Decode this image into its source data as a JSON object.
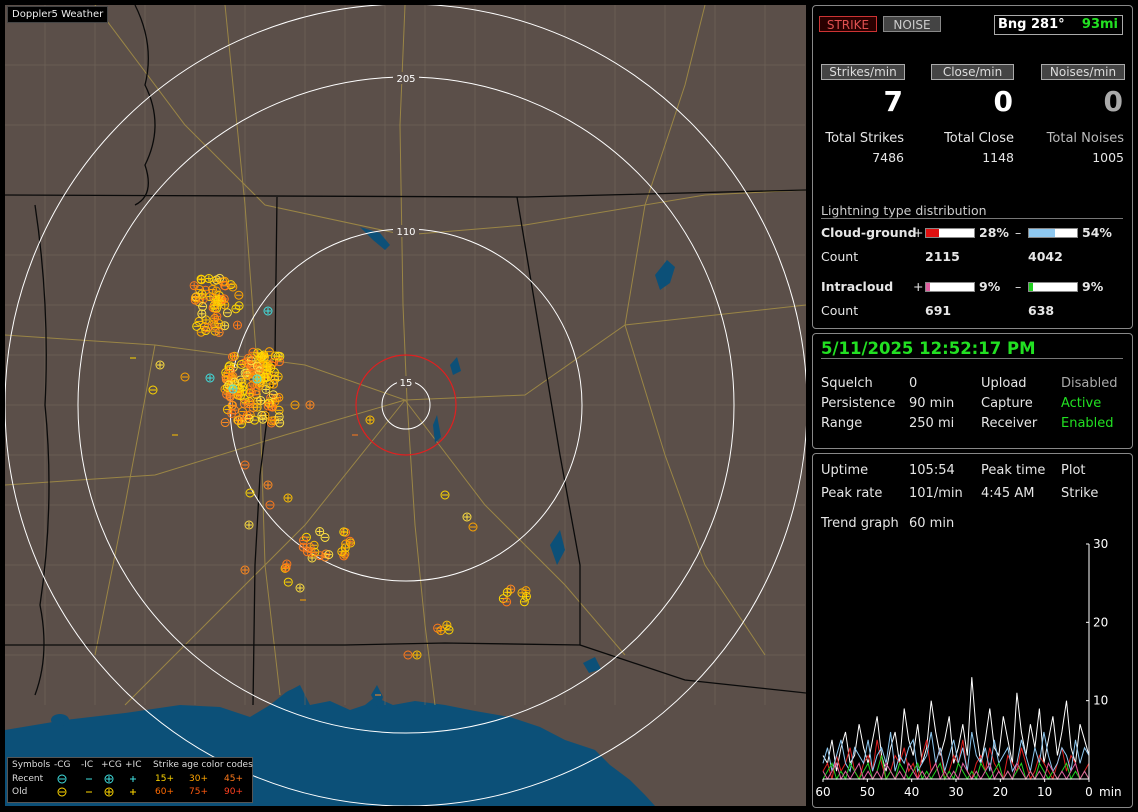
{
  "map": {
    "title": "Doppler5 Weather",
    "range_labels": [
      "205",
      "110",
      "15"
    ],
    "legend": {
      "symbols_label": "Symbols",
      "neg_cg": "-CG",
      "neg_ic": "-IC",
      "pos_cg": "+CG",
      "pos_ic": "+IC",
      "age_title": "Strike age color codes",
      "recent_label": "Recent",
      "old_label": "Old",
      "ages_recent": [
        "15+",
        "30+",
        "45+"
      ],
      "ages_old": [
        "60+",
        "75+",
        "90+"
      ],
      "age_colors": [
        "#ffd700",
        "#ffa500",
        "#ff7a1a",
        "#ff6a00",
        "#ff5a10",
        "#ff4020"
      ]
    },
    "colors": {
      "land": "#5b4f49",
      "water": "#0c5078",
      "state_border": "#0a0a0a",
      "county_border": "#6e6358",
      "roads": "#a58f45",
      "range_ring": "#ffffff",
      "close_ring": "#e02020"
    }
  },
  "controls": {
    "strike_label": "STRIKE",
    "noise_label": "NOISE",
    "bearing": "Bng 281°",
    "distance": "93mi"
  },
  "rates": {
    "strikes_label": "Strikes/min",
    "close_label": "Close/min",
    "noises_label": "Noises/min",
    "strikes_value": "7",
    "close_value": "0",
    "noises_value": "0"
  },
  "totals": {
    "strikes_label": "Total Strikes",
    "close_label": "Total Close",
    "noises_label": "Total Noises",
    "strikes_value": "7486",
    "close_value": "1148",
    "noises_value": "1005"
  },
  "distribution": {
    "title": "Lightning type distribution",
    "count_label": "Count",
    "cloud_ground": {
      "label": "Cloud-ground",
      "plus_sign": "+",
      "minus_sign": "–",
      "pos_pct": "28%",
      "neg_pct": "54%",
      "pos_fraction": 0.28,
      "neg_fraction": 0.54,
      "pos_count": "2115",
      "neg_count": "4042",
      "pos_color": "#e01010",
      "neg_color": "#8ec8f0"
    },
    "intracloud": {
      "label": "Intracloud",
      "plus_sign": "+",
      "minus_sign": "–",
      "pos_pct": "9%",
      "neg_pct": "9%",
      "pos_fraction": 0.09,
      "neg_fraction": 0.09,
      "pos_count": "691",
      "neg_count": "638",
      "pos_color": "#e060a0",
      "neg_color": "#20d020"
    }
  },
  "status": {
    "datetime": "5/11/2025 12:52:17 PM",
    "squelch_label": "Squelch",
    "squelch_value": "0",
    "persistence_label": "Persistence",
    "persistence_value": "90 min",
    "range_label": "Range",
    "range_value": "250 mi",
    "upload_label": "Upload",
    "upload_value": "Disabled",
    "capture_label": "Capture",
    "capture_value": "Active",
    "receiver_label": "Receiver",
    "receiver_value": "Enabled"
  },
  "stats": {
    "uptime_label": "Uptime",
    "uptime_value": "105:54",
    "peak_time_label": "Peak time",
    "peak_time_value": "4:45 AM",
    "plot_label": "Plot",
    "plot_value": "Strike",
    "peak_rate_label": "Peak rate",
    "peak_rate_value": "101/min",
    "trend_label": "Trend graph",
    "trend_value": "60 min"
  },
  "chart_data": {
    "type": "line",
    "x_ticks": [
      "60",
      "50",
      "40",
      "30",
      "20",
      "10",
      "0"
    ],
    "x_unit": "min",
    "y_ticks": [
      "30",
      "20",
      "10"
    ],
    "ylim": [
      0,
      30
    ],
    "xlim": [
      60,
      0
    ],
    "series": [
      {
        "color": "#ffffff",
        "values": [
          3,
          2,
          5,
          1,
          4,
          6,
          2,
          3,
          7,
          4,
          2,
          5,
          8,
          3,
          1,
          4,
          6,
          2,
          9,
          5,
          3,
          7,
          2,
          4,
          10,
          6,
          3,
          5,
          8,
          2,
          4,
          7,
          3,
          13,
          6,
          2,
          5,
          9,
          4,
          3,
          8,
          5,
          2,
          11,
          6,
          3,
          7,
          4,
          9,
          2,
          5,
          8,
          3,
          6,
          10,
          4,
          2,
          7,
          5,
          3
        ]
      },
      {
        "color": "#e02020",
        "values": [
          1,
          2,
          0,
          3,
          1,
          2,
          4,
          1,
          0,
          2,
          3,
          1,
          5,
          2,
          0,
          1,
          3,
          2,
          4,
          1,
          2,
          0,
          3,
          5,
          1,
          2,
          4,
          0,
          1,
          3,
          2,
          5,
          1,
          0,
          2,
          3,
          1,
          4,
          2,
          1,
          0,
          3,
          2,
          1,
          4,
          2,
          0,
          1,
          3,
          2,
          1,
          0,
          2,
          4,
          1,
          3,
          2,
          0,
          1,
          2
        ]
      },
      {
        "color": "#8ec8f0",
        "values": [
          2,
          4,
          1,
          3,
          5,
          2,
          1,
          4,
          3,
          2,
          5,
          1,
          3,
          4,
          2,
          6,
          1,
          3,
          2,
          4,
          5,
          1,
          2,
          3,
          6,
          2,
          4,
          1,
          3,
          5,
          2,
          4,
          1,
          6,
          3,
          2,
          4,
          1,
          5,
          2,
          3,
          4,
          1,
          2,
          5,
          3,
          1,
          4,
          2,
          6,
          3,
          1,
          2,
          4,
          3,
          1,
          5,
          2,
          4,
          3
        ]
      },
      {
        "color": "#20d020",
        "values": [
          0,
          1,
          2,
          0,
          1,
          0,
          2,
          1,
          0,
          1,
          2,
          0,
          1,
          3,
          0,
          1,
          0,
          2,
          1,
          0,
          1,
          2,
          0,
          1,
          0,
          1,
          2,
          0,
          1,
          0,
          2,
          1,
          0,
          1,
          0,
          2,
          1,
          0,
          1,
          2,
          0,
          1,
          0,
          1,
          2,
          0,
          1,
          0,
          2,
          1,
          0,
          1,
          0,
          1,
          2,
          0,
          1,
          0,
          1,
          0
        ]
      },
      {
        "color": "#e060a0",
        "values": [
          1,
          0,
          1,
          2,
          0,
          1,
          0,
          1,
          2,
          0,
          1,
          0,
          1,
          0,
          2,
          1,
          0,
          1,
          0,
          2,
          1,
          0,
          1,
          0,
          1,
          2,
          0,
          1,
          0,
          1,
          0,
          2,
          1,
          0,
          1,
          0,
          1,
          2,
          0,
          1,
          0,
          1,
          0,
          2,
          1,
          0,
          1,
          0,
          1,
          0,
          2,
          1,
          0,
          1,
          0,
          1,
          2,
          0,
          1,
          0
        ]
      }
    ]
  }
}
